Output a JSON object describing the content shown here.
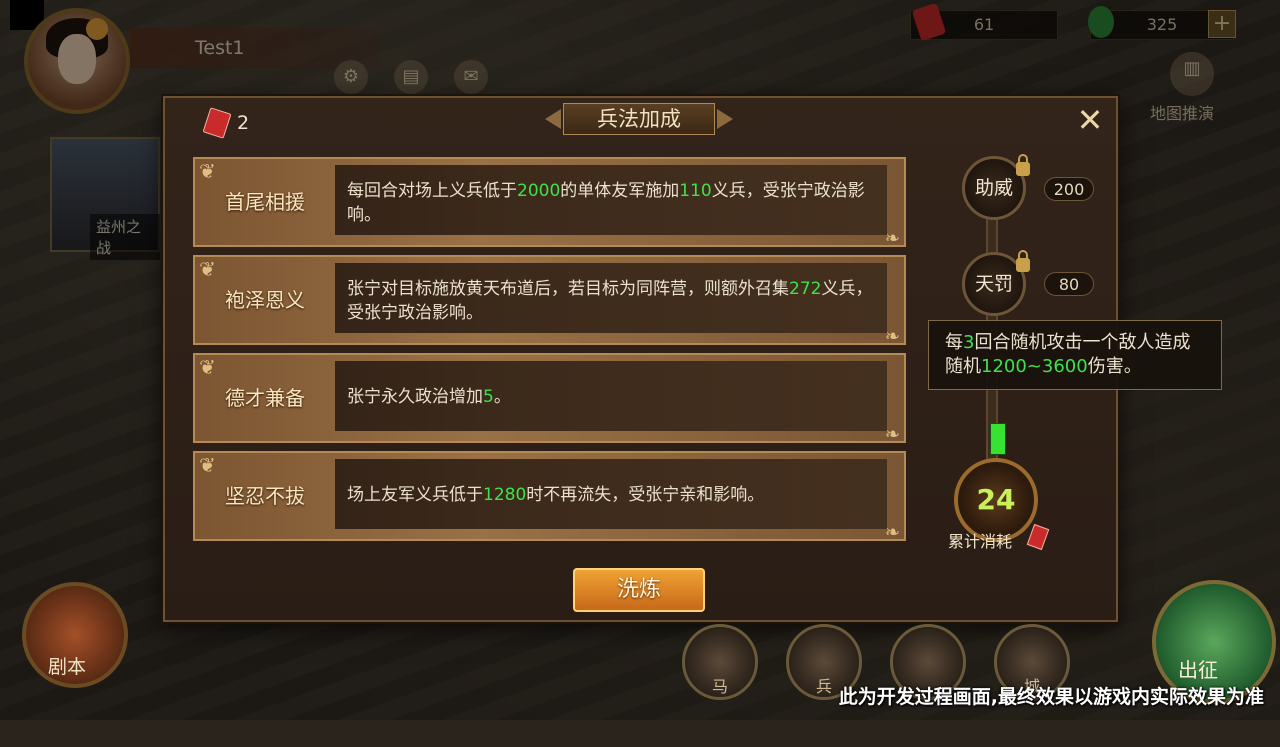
{
  "player": {
    "name": "Test1"
  },
  "resources": {
    "red_tokens": "61",
    "jade": "325",
    "plus_label": "+"
  },
  "top_icons": [
    "settings-icon",
    "scroll-icon",
    "mail-icon"
  ],
  "map_button_label": "地图推演",
  "side_card_label": "益州之战",
  "dialog": {
    "title": "兵法加成",
    "book_count": "2",
    "close_label": "✕",
    "rows": [
      {
        "name": "首尾相援",
        "desc_parts": [
          "每回合对场上义兵低于",
          "2000",
          "的单体友军施加",
          "110",
          "义兵，受张宁政治影响。"
        ]
      },
      {
        "name": "袍泽恩义",
        "desc_parts": [
          "张宁对目标施放黄天布道后，若目标为同阵营，则额外召集",
          "272",
          "义兵，受张宁政治影响。"
        ]
      },
      {
        "name": "德才兼备",
        "desc_parts": [
          "张宁永久政治增加",
          "5",
          "。"
        ]
      },
      {
        "name": "坚忍不拔",
        "desc_parts": [
          "场上友军义兵低于",
          "1280",
          "时不再流失，受张宁亲和影响。"
        ]
      }
    ],
    "skills": [
      {
        "name": "助威",
        "cost": "200"
      },
      {
        "name": "天罚",
        "cost": "80"
      }
    ],
    "tooltip_parts": [
      "每",
      "3",
      "回合随机攻击一个敌人造成随机",
      "1200~3600",
      "伤害。"
    ],
    "accumulated_value": "24",
    "accumulated_label": "累计消耗",
    "refine_label": "洗炼"
  },
  "bottom": {
    "juben_label": "剧本",
    "chuzheng_label": "出征",
    "icon_labels": [
      "马",
      "兵",
      "",
      "城"
    ]
  },
  "notice": "此为开发过程画面,最终效果以游戏内实际效果为准",
  "colors": {
    "highlight": "#3ee24a",
    "button_orange": "#e08a28",
    "frame_gold": "#b48b55"
  }
}
